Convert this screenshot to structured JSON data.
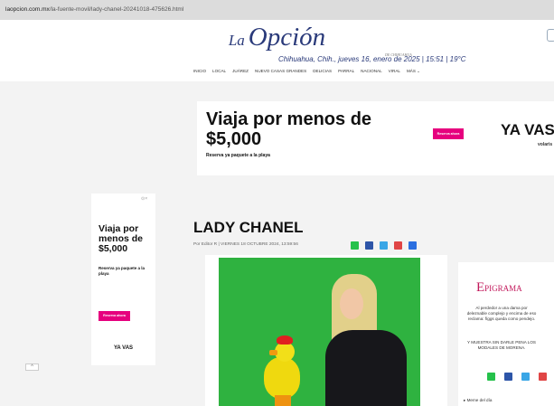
{
  "browser": {
    "url_host": "laopcion.com.mx",
    "url_path": "/la-fuente-movil/lady-chanel-20241018-475626.html"
  },
  "site": {
    "logo_la": "La",
    "logo_opcion": "Opción",
    "logo_sub": "DE CHIHUAHUA",
    "dateline": "Chihuahua, Chih., jueves 16, enero de 2025 | 15:51 | 19°C",
    "nav": [
      "INICIO",
      "LOCAL",
      "JUÁREZ",
      "NUEVO CASAS GRANDES",
      "DELICIAS",
      "PARRAL",
      "NACIONAL",
      "VIRAL",
      "MÁS ⌄"
    ]
  },
  "banner_ad": {
    "headline": "Viaja por menos de $5,000",
    "subline": "Reserva ya paquete a la playa",
    "button": "Reserva ahora",
    "brand": "YA VAS",
    "brand_sub": "volaris"
  },
  "side_ad": {
    "close": "⊙×",
    "headline": "Viaja por menos de $5,000",
    "subline": "Reserva ya paquete a la playa",
    "button": "Reserva ahora",
    "brand": "YA VAS",
    "arrow": "^"
  },
  "article": {
    "title": "LADY CHANEL",
    "byline": "Por Editor R  |  VIERNES 18 OCTUBRE 2024, 13:59:56",
    "share_icons": [
      "whatsapp-icon",
      "facebook-icon",
      "twitter-icon",
      "email-icon",
      "link-icon"
    ]
  },
  "right_ad": {
    "logo_e": "E",
    "logo_rest": "PIGRAMA",
    "line1": "Al perdedor a una dama por deleznable complejo y encima de eso reclama: fíggs queda como pendejo.",
    "line2": "Y MUESTRA SIN DARLE PENA LOS MODALES DE MORENA."
  },
  "right_sidebar": {
    "menu_item": "▸ Meme del día"
  },
  "colors": {
    "brand_blue": "#2a3a7a",
    "ad_magenta": "#e6007e",
    "photo_green": "#2fb240"
  }
}
